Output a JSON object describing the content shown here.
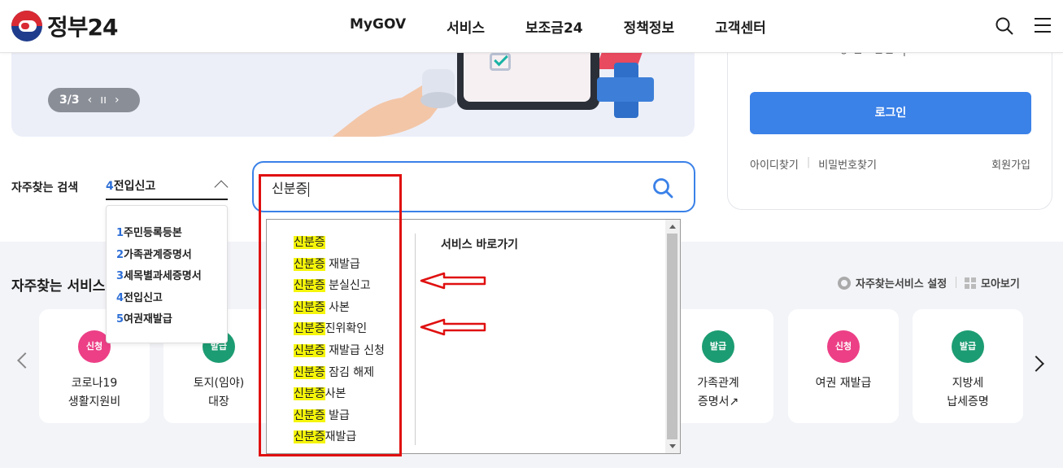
{
  "header": {
    "logo_text": "정부24",
    "nav": [
      "MyGOV",
      "서비스",
      "보조금24",
      "정책정보",
      "고객센터"
    ]
  },
  "banner": {
    "pager": "3/3",
    "prev": "‹",
    "pause": "ıı",
    "next": "›"
  },
  "login": {
    "hint": "ㅎ  ㄹㅡㅂㄴ ㅓ",
    "button": "로그인",
    "find_id": "아이디찾기",
    "find_pw": "비밀번호찾기",
    "signup": "회원가입"
  },
  "frequent_search": {
    "label": "자주찾는 검색",
    "selected_num": "4",
    "selected_text": "전입신고",
    "options": [
      {
        "num": "1",
        "text": "주민등록등본"
      },
      {
        "num": "2",
        "text": "가족관계증명서"
      },
      {
        "num": "3",
        "text": "세목별과세증명서"
      },
      {
        "num": "4",
        "text": "전입신고"
      },
      {
        "num": "5",
        "text": "여권재발급"
      }
    ]
  },
  "search": {
    "value": "신분증"
  },
  "autocomplete": {
    "items": [
      {
        "hl": "신분증",
        "rest": ""
      },
      {
        "hl": "신분증",
        "rest": " 재발급"
      },
      {
        "hl": "신분증",
        "rest": " 분실신고"
      },
      {
        "hl": "신분증",
        "rest": " 사본"
      },
      {
        "hl": "신분증",
        "rest": "진위확인"
      },
      {
        "hl": "신분증",
        "rest": " 재발급 신청"
      },
      {
        "hl": "신분증",
        "rest": " 잠김 해제"
      },
      {
        "hl": "신분증",
        "rest": "사본"
      },
      {
        "hl": "신분증",
        "rest": " 발급"
      },
      {
        "hl": "신분증",
        "rest": "재발급"
      }
    ],
    "heading": "서비스 바로가기"
  },
  "services": {
    "title": "자주찾는 서비스",
    "settings": "자주찾는서비스 설정",
    "view_all": "모아보기",
    "cards": [
      {
        "badge": "신청",
        "color": "pink",
        "label": "코로나19\n생활지원비"
      },
      {
        "badge": "발급",
        "color": "green",
        "label": "토지(임야)\n대장"
      },
      {
        "badge": "발급",
        "color": "green",
        "label": "가족관계\n증명서↗"
      },
      {
        "badge": "신청",
        "color": "pink",
        "label": "여권 재발급"
      },
      {
        "badge": "발급",
        "color": "green",
        "label": "지방세\n납세증명"
      }
    ]
  },
  "colors": {
    "accent": "#3a81e8",
    "highlight": "#f5f50a",
    "annotation": "#e01010"
  }
}
